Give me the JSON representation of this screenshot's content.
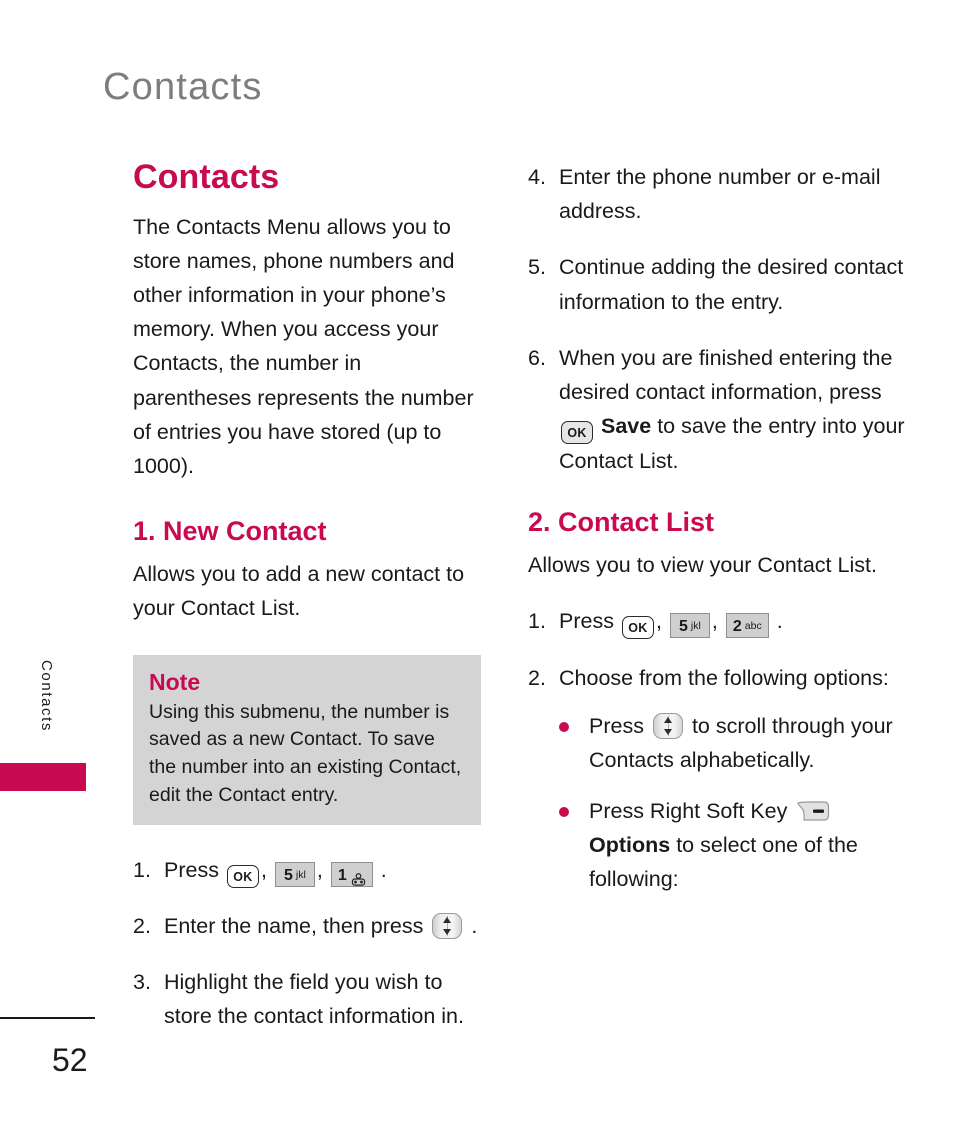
{
  "page": {
    "running_header": "Contacts",
    "page_number": "52",
    "side_tab_label": "Contacts",
    "accent_color": "#c80a50",
    "header_gray": "#7d7d7d",
    "note_bg": "#d4d4d4"
  },
  "left_column": {
    "section_title": "Contacts",
    "intro": "The Contacts Menu allows you to store names, phone numbers and other information in your phone’s memory. When you access your Contacts, the number in parentheses represents the number of entries you have stored (up to 1000).",
    "subsection": {
      "title": "1. New Contact",
      "description": "Allows you to add a new contact to your Contact List."
    },
    "note": {
      "title": "Note",
      "body": "Using this submenu, the number is saved as a new Contact. To save the number into an existing Contact, edit the Contact entry."
    },
    "steps": [
      {
        "num": "1.",
        "before": "Press",
        "keys": [
          "ok",
          "5jkl",
          "1vm"
        ],
        "after": "."
      },
      {
        "num": "2.",
        "before": "Enter the name, then press",
        "keys": [
          "nav"
        ],
        "after": "."
      },
      {
        "num": "3.",
        "text": "Highlight the field you wish to store the contact information in."
      }
    ]
  },
  "right_column": {
    "steps_continued": [
      {
        "num": "4.",
        "text": "Enter the phone number or e-mail address."
      },
      {
        "num": "5.",
        "text": "Continue adding the desired contact information to the entry."
      },
      {
        "num": "6.",
        "part1": "When you are finished entering the desired contact information, press",
        "key": "ok-filled",
        "bold": "Save",
        "part2": "to save the entry into your Contact List."
      }
    ],
    "subsection": {
      "title": "2. Contact List",
      "description": "Allows you to view your Contact List."
    },
    "steps": [
      {
        "num": "1.",
        "before": "Press",
        "keys": [
          "ok",
          "5jkl",
          "2abc"
        ],
        "after": "."
      },
      {
        "num": "2.",
        "text": "Choose from the following options:"
      }
    ],
    "bullets": [
      {
        "before": "Press",
        "key": "nav",
        "after": "to scroll through your Contacts alphabetically."
      },
      {
        "before": "Press Right Soft Key",
        "key": "softkey-right",
        "bold": "Options",
        "after": "to select one of the following:"
      }
    ]
  },
  "keys": {
    "ok_label": "OK",
    "five_digit": "5",
    "five_letters": "jkl",
    "one_digit": "1",
    "two_digit": "2",
    "two_letters": "abc"
  }
}
